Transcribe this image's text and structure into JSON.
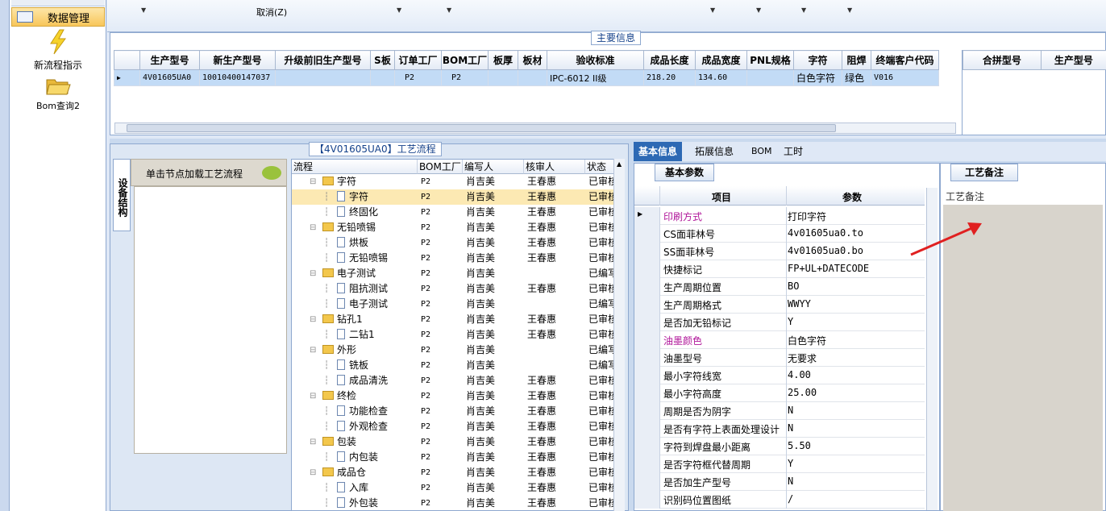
{
  "nav": {
    "top_item": "数据管理",
    "items": [
      {
        "label": "新流程指示",
        "icon": "lightning-icon"
      },
      {
        "label": "Bom查询2",
        "icon": "folder-open-icon"
      }
    ]
  },
  "toolbar": {
    "cancel_label": "取消(Z)"
  },
  "main_info": {
    "title": "主要信息",
    "columns": [
      "生产型号",
      "新生产型号",
      "升级前旧生产型号",
      "S板",
      "订单工厂",
      "BOM工厂",
      "板厚",
      "板材",
      "验收标准",
      "成品长度",
      "成品宽度",
      "PNL规格",
      "字符",
      "阻焊",
      "终端客户代码"
    ],
    "row": [
      "4V01605UA0",
      "10010400147037",
      "",
      "",
      "P2",
      "P2",
      "",
      "",
      "IPC-6012 II级",
      "218.20",
      "134.60",
      "",
      "白色字符",
      "绿色",
      "V016"
    ],
    "side_columns": [
      "合拼型号",
      "生产型号"
    ]
  },
  "flow": {
    "title": "【4V01605UA0】工艺流程",
    "side_tab": "设备结构",
    "hint": "单击节点加载工艺流程",
    "columns": [
      "流程",
      "BOM工厂",
      "编写人",
      "核审人",
      "状态"
    ],
    "rows": [
      {
        "name": "字符",
        "level": 1,
        "bom": "P2",
        "writer": "肖吉美",
        "reviewer": "王春惠",
        "status": "已审核"
      },
      {
        "name": "字符",
        "level": 2,
        "bom": "P2",
        "writer": "肖吉美",
        "reviewer": "王春惠",
        "status": "已审核",
        "selected": true
      },
      {
        "name": "终固化",
        "level": 2,
        "bom": "P2",
        "writer": "肖吉美",
        "reviewer": "王春惠",
        "status": "已审核"
      },
      {
        "name": "无铅喷锡",
        "level": 1,
        "bom": "P2",
        "writer": "肖吉美",
        "reviewer": "王春惠",
        "status": "已审核"
      },
      {
        "name": "烘板",
        "level": 2,
        "bom": "P2",
        "writer": "肖吉美",
        "reviewer": "王春惠",
        "status": "已审核"
      },
      {
        "name": "无铅喷锡",
        "level": 2,
        "bom": "P2",
        "writer": "肖吉美",
        "reviewer": "王春惠",
        "status": "已审核"
      },
      {
        "name": "电子测试",
        "level": 1,
        "bom": "P2",
        "writer": "肖吉美",
        "reviewer": "",
        "status": "已编写"
      },
      {
        "name": "阻抗测试",
        "level": 2,
        "bom": "P2",
        "writer": "肖吉美",
        "reviewer": "王春惠",
        "status": "已审核"
      },
      {
        "name": "电子测试",
        "level": 2,
        "bom": "P2",
        "writer": "肖吉美",
        "reviewer": "",
        "status": "已编写"
      },
      {
        "name": "钻孔1",
        "level": 1,
        "bom": "P2",
        "writer": "肖吉美",
        "reviewer": "王春惠",
        "status": "已审核"
      },
      {
        "name": "二钻1",
        "level": 2,
        "bom": "P2",
        "writer": "肖吉美",
        "reviewer": "王春惠",
        "status": "已审核"
      },
      {
        "name": "外形",
        "level": 1,
        "bom": "P2",
        "writer": "肖吉美",
        "reviewer": "",
        "status": "已编写"
      },
      {
        "name": "铣板",
        "level": 2,
        "bom": "P2",
        "writer": "肖吉美",
        "reviewer": "",
        "status": "已编写"
      },
      {
        "name": "成品清洗",
        "level": 2,
        "bom": "P2",
        "writer": "肖吉美",
        "reviewer": "王春惠",
        "status": "已审核"
      },
      {
        "name": "终检",
        "level": 1,
        "bom": "P2",
        "writer": "肖吉美",
        "reviewer": "王春惠",
        "status": "已审核"
      },
      {
        "name": "功能检查",
        "level": 2,
        "bom": "P2",
        "writer": "肖吉美",
        "reviewer": "王春惠",
        "status": "已审核"
      },
      {
        "name": "外观检查",
        "level": 2,
        "bom": "P2",
        "writer": "肖吉美",
        "reviewer": "王春惠",
        "status": "已审核"
      },
      {
        "name": "包装",
        "level": 1,
        "bom": "P2",
        "writer": "肖吉美",
        "reviewer": "王春惠",
        "status": "已审核"
      },
      {
        "name": "内包装",
        "level": 2,
        "bom": "P2",
        "writer": "肖吉美",
        "reviewer": "王春惠",
        "status": "已审核"
      },
      {
        "name": "成品仓",
        "level": 1,
        "bom": "P2",
        "writer": "肖吉美",
        "reviewer": "王春惠",
        "status": "已审核"
      },
      {
        "name": "入库",
        "level": 2,
        "bom": "P2",
        "writer": "肖吉美",
        "reviewer": "王春惠",
        "status": "已审核"
      },
      {
        "name": "外包装",
        "level": 2,
        "bom": "P2",
        "writer": "肖吉美",
        "reviewer": "王春惠",
        "status": "已审核"
      }
    ]
  },
  "tabs": [
    "基本信息",
    "拓展信息",
    "BOM",
    "工时"
  ],
  "props": {
    "section": "基本参数",
    "col_item": "项目",
    "col_value": "参数",
    "rows": [
      {
        "k": "印刷方式",
        "v": "打印字符",
        "highlight": true
      },
      {
        "k": "CS面菲林号",
        "v": "4v01605ua0.to"
      },
      {
        "k": "SS面菲林号",
        "v": "4v01605ua0.bo"
      },
      {
        "k": "快捷标记",
        "v": "FP+UL+DATECODE"
      },
      {
        "k": "生产周期位置",
        "v": "BO"
      },
      {
        "k": "生产周期格式",
        "v": "WWYY"
      },
      {
        "k": "是否加无铅标记",
        "v": "Y"
      },
      {
        "k": "油墨颜色",
        "v": "白色字符",
        "highlight": true
      },
      {
        "k": "油墨型号",
        "v": "无要求"
      },
      {
        "k": "最小字符线宽",
        "v": "4.00"
      },
      {
        "k": "最小字符高度",
        "v": "25.00"
      },
      {
        "k": "周期是否为阴字",
        "v": "N"
      },
      {
        "k": "是否有字符上表面处理设计",
        "v": "N"
      },
      {
        "k": "字符到焊盘最小距离",
        "v": "5.50"
      },
      {
        "k": "是否字符框代替周期",
        "v": "Y"
      },
      {
        "k": "是否加生产型号",
        "v": "N"
      },
      {
        "k": "识别码位置图纸",
        "v": "/"
      }
    ]
  },
  "remarks": {
    "tab": "工艺备注",
    "label": "工艺备注"
  },
  "colors": {
    "accent": "#2d69b4",
    "highlight_text": "#b0169a",
    "selection": "#fce9b3",
    "arrow": "#e02020"
  }
}
